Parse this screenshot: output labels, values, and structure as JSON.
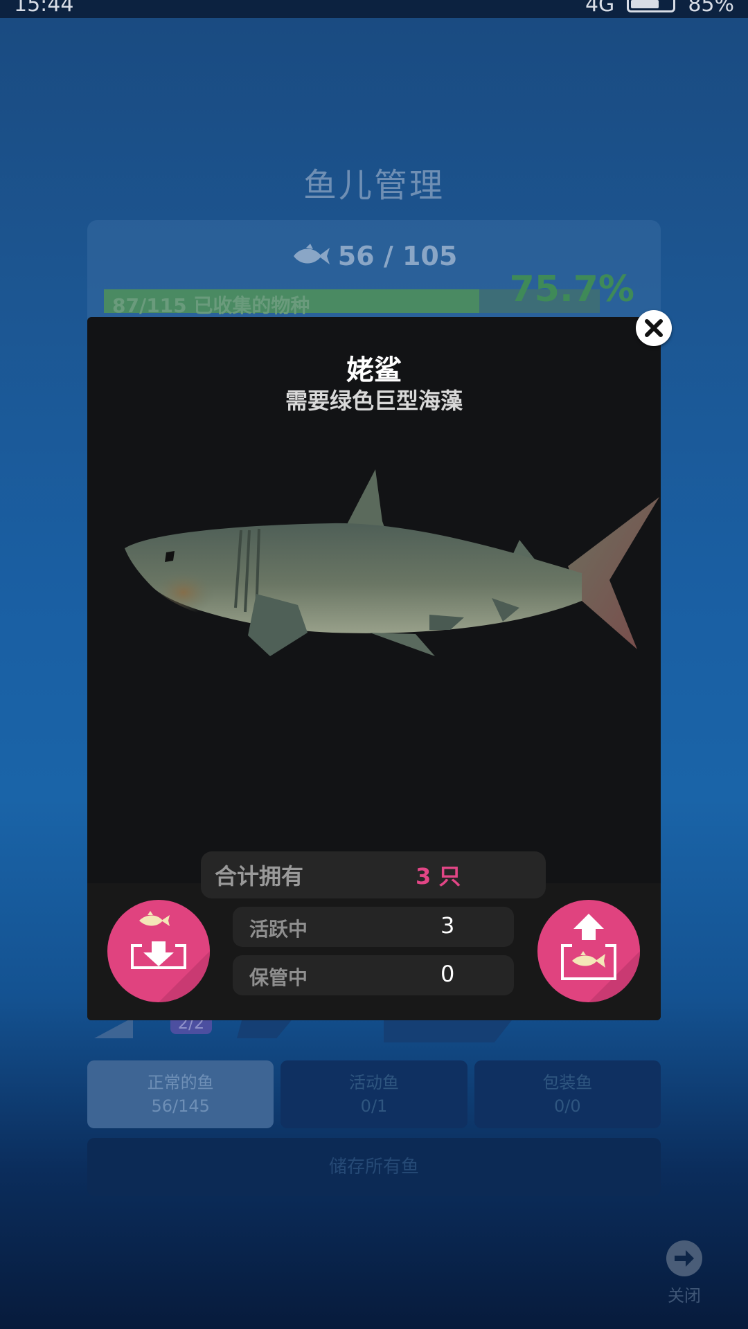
{
  "status_bar": {
    "time": "15:44",
    "network": "4G",
    "battery": "85%"
  },
  "background": {
    "title": "鱼儿管理",
    "fish_count": "56 / 105",
    "progress": {
      "label": "87/115 已收集的物种",
      "fraction": 0.757,
      "percent_text": "75.7%"
    },
    "badge": "2/2",
    "tabs": [
      {
        "name": "正常的鱼",
        "count": "56/145",
        "active": true
      },
      {
        "name": "活动鱼",
        "count": "0/1",
        "active": false
      },
      {
        "name": "包装鱼",
        "count": "0/0",
        "active": false
      }
    ],
    "store_all_label": "储存所有鱼",
    "close_label": "关闭"
  },
  "modal": {
    "fish_name": "姥鲨",
    "requirement": "需要绿色巨型海藻",
    "total_label": "合计拥有",
    "total_value": "3 只",
    "active_label": "活跃中",
    "active_value": "3",
    "stored_label": "保管中",
    "stored_value": "0"
  },
  "colors": {
    "accent_pink": "#e0437f",
    "modal_bg": "#121315",
    "progress_green": "#4a8a62"
  },
  "icons": {
    "close": "close-icon",
    "store": "store-fish-icon",
    "release": "release-fish-icon",
    "fish": "fish-icon",
    "arrow": "arrow-right-icon"
  }
}
